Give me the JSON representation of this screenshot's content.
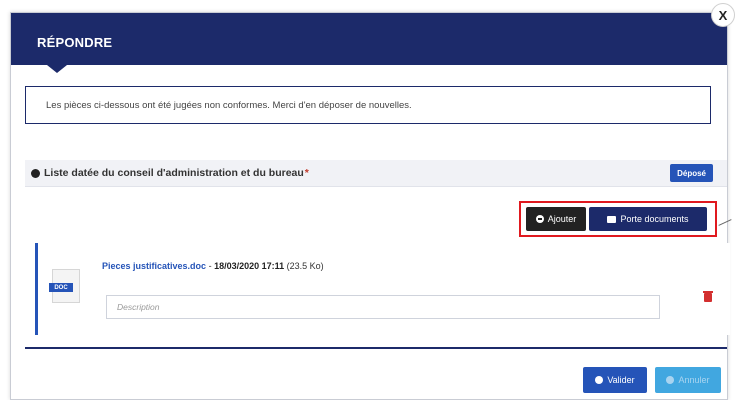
{
  "modal": {
    "title": "RÉPONDRE",
    "close_label": "X"
  },
  "notice": {
    "text": "Les pièces ci-dessous ont été jugées non conformes. Merci d'en déposer de nouvelles."
  },
  "section": {
    "title": "Liste datée du conseil d'administration et du bureau",
    "required_mark": "*",
    "status_label": "Déposé"
  },
  "actions": {
    "add_label": "Ajouter",
    "portfolio_label": "Porte documents"
  },
  "document": {
    "file_type": "DOC",
    "file_name": "Pieces justificatives.doc",
    "separator": " - ",
    "date": "18/03/2020 17:11",
    "size": " (23.5 Ko)",
    "description_placeholder": "Description"
  },
  "footer": {
    "validate_label": "Valider",
    "cancel_label": "Annuler"
  },
  "colors": {
    "header": "#1c2a6a",
    "primary": "#2554b8",
    "highlight_border": "#e0191f",
    "cancel": "#41a7e0",
    "delete": "#d32f2f"
  }
}
